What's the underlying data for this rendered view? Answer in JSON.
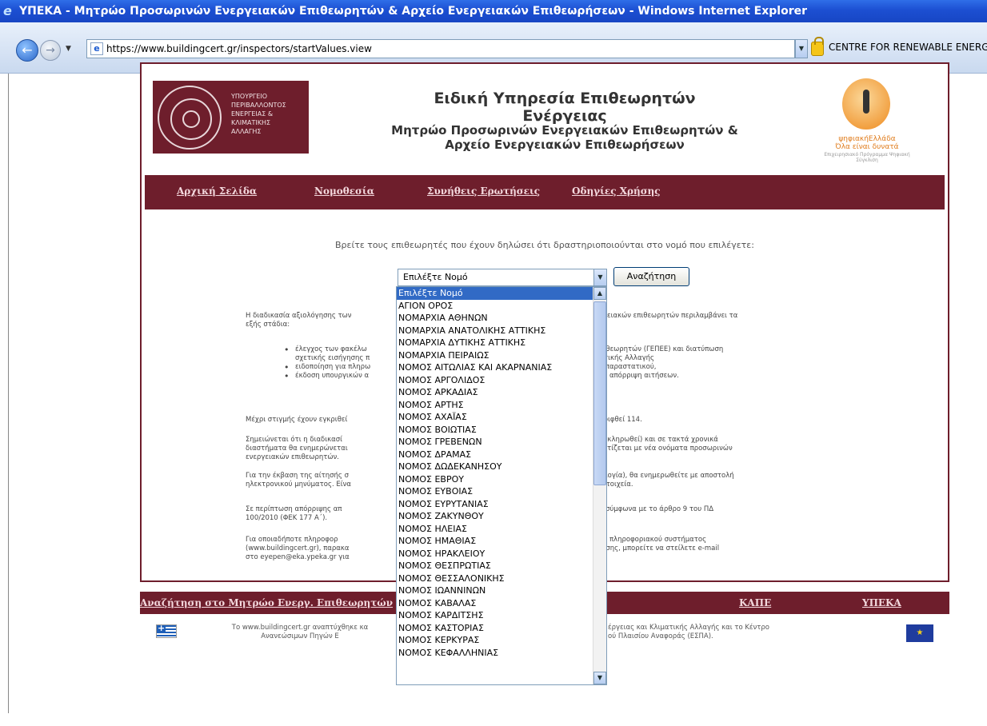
{
  "window": {
    "title": "ΥΠΕΚΑ - Μητρώο Προσωρινών Ενεργειακών Επιθεωρητών & Αρχείο Ενεργειακών Επιθεωρήσεων - Windows Internet Explorer",
    "url": "https://www.buildingcert.gr/inspectors/startValues.view",
    "certificate": "CENTRE FOR RENEWABLE ENERG"
  },
  "header": {
    "ministry_lines": [
      "ΥΠΟΥΡΓΕΙΟ",
      "ΠΕΡΙΒΑΛΛΟΝΤΟΣ",
      "ΕΝΕΡΓΕΙΑΣ &",
      "ΚΛΙΜΑΤΙΚΗΣ",
      "ΑΛΛΑΓΗΣ"
    ],
    "title": "Ειδική Υπηρεσία Επιθεωρητών Ενέργειας",
    "subtitle_line1": "Μητρώο Προσωρινών Ενεργειακών Επιθεωρητών &",
    "subtitle_line2": "Αρχείο Ενεργειακών Επιθεωρήσεων",
    "right_logo_text": "ψηφιακήΕλλάδα",
    "right_logo_slogan": "Όλα είναι δυνατά",
    "right_logo_small": "Επιχειρησιακό Πρόγραμμα Ψηφιακή Σύγκλιση"
  },
  "nav": {
    "home": "Αρχική Σελίδα",
    "legislation": "Νομοθεσία",
    "faq": "Συνήθεις Ερωτήσεις",
    "guide": "Οδηγίες Χρήσης"
  },
  "search": {
    "prompt": "Βρείτε τους επιθεωρητές που έχουν δηλώσει ότι δραστηριοποιούνται στο νομό που επιλέγετε:",
    "selected": "Επιλέξτε Νομό",
    "button": "Αναζήτηση"
  },
  "body": {
    "intro_left": "Η διαδικασία αξιολόγησης των",
    "intro_right": "εργειακών επιθεωρητών περιλαμβάνει τα",
    "intro_cont": "εξής στάδια:",
    "bullet1_left": "έλεγχος των φακέλω",
    "bullet1_right": "Επιθεωρητών (ΓΕΠΕΕ) και διατύπωση",
    "bullet1b_left": "σχετικής εισήγησης π",
    "bullet1b_right": "ματικής Αλλαγής",
    "bullet2_left": "ειδοποίηση για πληρω",
    "bullet2_right": "ού παραστατικού,",
    "bullet3_left": "έκδοση υπουργικών α",
    "bullet3_right": "την απόρριψη αιτήσεων.",
    "approved_left": "Μέχρι στιγμής έχουν εγκριθεί",
    "approved_right": "ορριφθεί 114.",
    "note1_l1_left": "Σημειώνεται ότι η διαδικασί",
    "note1_l1_right": "ολοκληρωθεί) και σε τακτά χρονικά",
    "note1_l2_left": "διαστήματα θα ενημερώνεται",
    "note1_l2_right": "λουτίζεται με νέα ονόματα προσωρινών",
    "note1_l3": "ενεργειακών επιθεωρητών.",
    "note2_l1_left": "Για την έκβαση της αίτησής σ",
    "note2_l1_right": "ορλογία), θα ενημερωθείτε με αποστολή",
    "note2_l2_left": "ηλεκτρονικού μηνύματος. Είνα",
    "note2_l2_right": "ά στοιχεία.",
    "note3_l1_left": "Σε περίπτωση απόρριψης απ",
    "note3_l1_right": "ής σύμφωνα με το άρθρο 9 του ΠΔ",
    "note3_l2": "100/2010 (ΦΕΚ 177 Α΄).",
    "note4_l1_left": "Για οποιαδήποτε πληροφορ",
    "note4_l1_right": "του πληροφοριακού συστήματος",
    "note4_l2_left": "(www.buildingcert.gr), παρακα",
    "note4_l2_right": "Επίσης, μπορείτε να στείλετε e-mail",
    "note4_l3_left": "στο eyepen@eka.ypeka.gr για"
  },
  "dropdown": {
    "options": [
      "Επιλέξτε Νομό",
      "ΑΓΙΟΝ ΟΡΟΣ",
      "ΝΟΜΑΡΧΙΑ ΑΘΗΝΩΝ",
      "ΝΟΜΑΡΧΙΑ ΑΝΑΤΟΛΙΚΗΣ ΑΤΤΙΚΗΣ",
      "ΝΟΜΑΡΧΙΑ ΔΥΤΙΚΗΣ ΑΤΤΙΚΗΣ",
      "ΝΟΜΑΡΧΙΑ ΠΕΙΡΑΙΩΣ",
      "ΝΟΜΟΣ ΑΙΤΩΛΙΑΣ ΚΑΙ ΑΚΑΡΝΑΝΙΑΣ",
      "ΝΟΜΟΣ ΑΡΓΟΛΙΔΟΣ",
      "ΝΟΜΟΣ ΑΡΚΑΔΙΑΣ",
      "ΝΟΜΟΣ ΑΡΤΗΣ",
      "ΝΟΜΟΣ ΑΧΑΪΑΣ",
      "ΝΟΜΟΣ ΒΟΙΩΤΙΑΣ",
      "ΝΟΜΟΣ ΓΡΕΒΕΝΩΝ",
      "ΝΟΜΟΣ ΔΡΑΜΑΣ",
      "ΝΟΜΟΣ ΔΩΔΕΚΑΝΗΣΟΥ",
      "ΝΟΜΟΣ ΕΒΡΟΥ",
      "ΝΟΜΟΣ ΕΥΒΟΙΑΣ",
      "ΝΟΜΟΣ ΕΥΡΥΤΑΝΙΑΣ",
      "ΝΟΜΟΣ ΖΑΚΥΝΘΟΥ",
      "ΝΟΜΟΣ ΗΛΕΙΑΣ",
      "ΝΟΜΟΣ ΗΜΑΘΙΑΣ",
      "ΝΟΜΟΣ ΗΡΑΚΛΕΙΟΥ",
      "ΝΟΜΟΣ ΘΕΣΠΡΩΤΙΑΣ",
      "ΝΟΜΟΣ ΘΕΣΣΑΛΟΝΙΚΗΣ",
      "ΝΟΜΟΣ ΙΩΑΝΝΙΝΩΝ",
      "ΝΟΜΟΣ ΚΑΒΑΛΑΣ",
      "ΝΟΜΟΣ ΚΑΡΔΙΤΣΗΣ",
      "ΝΟΜΟΣ ΚΑΣΤΟΡΙΑΣ",
      "ΝΟΜΟΣ ΚΕΡΚΥΡΑΣ",
      "ΝΟΜΟΣ ΚΕΦΑΛΛΗΝΙΑΣ"
    ]
  },
  "footer": {
    "search_link": "Αναζήτηση στο Μητρώο Ενεργ. Επιθεωρητών",
    "kape": "ΚΑΠΕ",
    "ypeka": "ΥΠΕΚΑ",
    "text_l1_left": "Το www.buildingcert.gr αναπτύχθηκε κα",
    "text_l1_right": "έργειας και Κλιματικής Αλλαγής και το Κέντρο",
    "text_l2_left": "Ανανεώσιμων Πηγών Ε",
    "text_l2_right": "ού Πλαισίου Αναφοράς (ΕΣΠΑ)."
  },
  "colors": {
    "brand": "#6e1e2c",
    "selection": "#316ac5",
    "titlebar": "#1c4fd2"
  }
}
